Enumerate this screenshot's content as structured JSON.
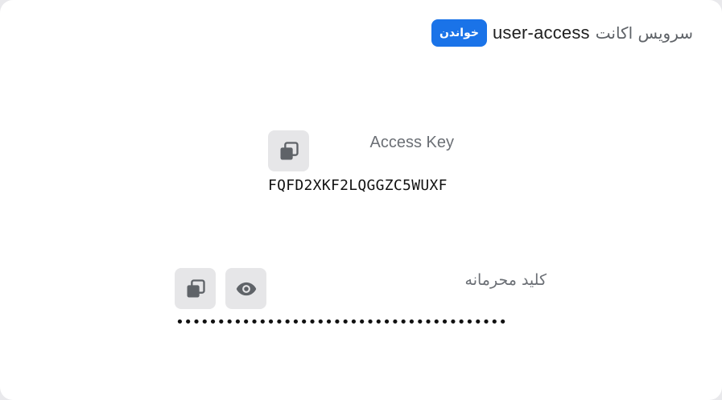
{
  "header": {
    "title_prefix": "سرویس اکانت",
    "account_name": "user-access",
    "permission_badge": "خواندن"
  },
  "access_key": {
    "label": "Access Key",
    "value": "FQFD2XKF2LQGGZC5WUXF",
    "copy_icon": "copy-icon"
  },
  "secret_key": {
    "label": "کلید محرمانه",
    "masked_value": "••••••••••••••••••••••••••••••••••••••••",
    "copy_icon": "copy-icon",
    "reveal_icon": "eye-icon"
  },
  "colors": {
    "badge_bg": "#1a73e8",
    "button_bg": "#e6e6e8",
    "icon": "#5f6368"
  }
}
